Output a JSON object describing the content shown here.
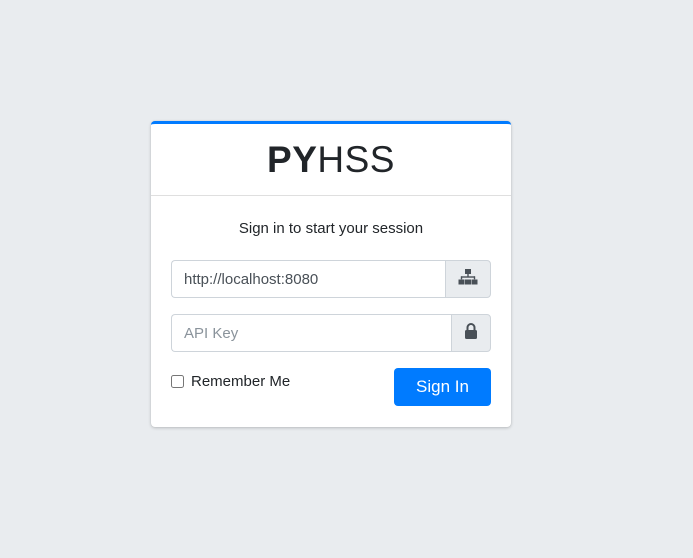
{
  "brand": {
    "bold": "PY",
    "light": "HSS"
  },
  "login": {
    "message": "Sign in to start your session",
    "url_field": {
      "value": "http://localhost:8080",
      "icon": "sitemap-icon"
    },
    "api_key_field": {
      "placeholder": "API Key",
      "icon": "lock-icon"
    },
    "remember_label": "Remember Me",
    "submit_label": "Sign In"
  },
  "colors": {
    "accent": "#007bff",
    "background": "#e9ecef",
    "addon_bg": "#e9ecef"
  }
}
